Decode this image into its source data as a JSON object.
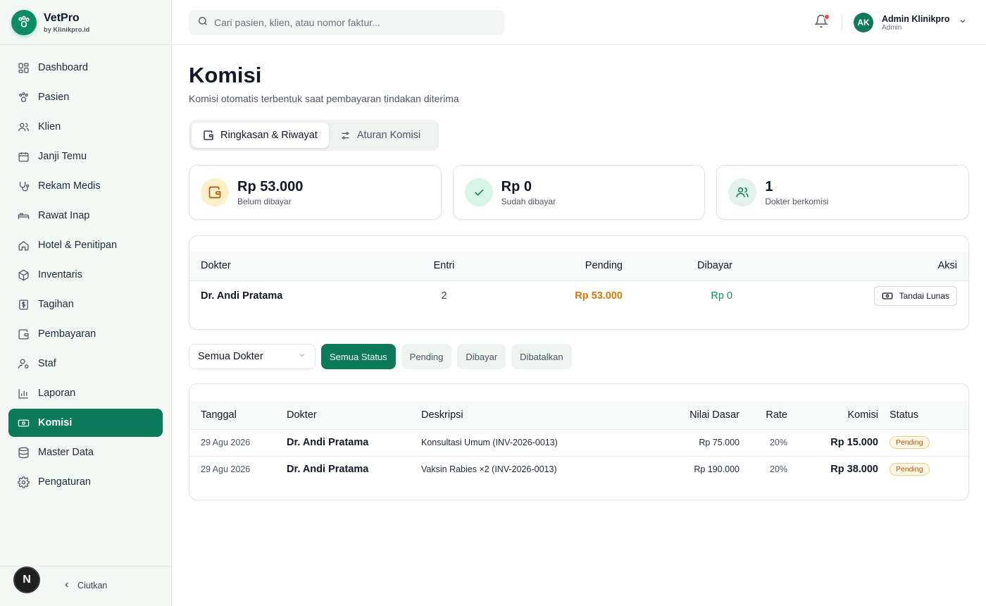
{
  "brand": {
    "name": "VetPro",
    "sub": "by Klinikpro.id"
  },
  "sidebar": {
    "items": [
      {
        "label": "Dashboard",
        "icon": "dashboard-icon"
      },
      {
        "label": "Pasien",
        "icon": "paw-icon"
      },
      {
        "label": "Klien",
        "icon": "users-icon"
      },
      {
        "label": "Janji Temu",
        "icon": "calendar-icon"
      },
      {
        "label": "Rekam Medis",
        "icon": "stethoscope-icon"
      },
      {
        "label": "Rawat Inap",
        "icon": "bed-icon"
      },
      {
        "label": "Hotel & Penitipan",
        "icon": "home-icon"
      },
      {
        "label": "Inventaris",
        "icon": "box-icon"
      },
      {
        "label": "Tagihan",
        "icon": "invoice-icon"
      },
      {
        "label": "Pembayaran",
        "icon": "wallet-icon"
      },
      {
        "label": "Staf",
        "icon": "staff-icon"
      },
      {
        "label": "Laporan",
        "icon": "chart-icon"
      },
      {
        "label": "Komisi",
        "icon": "banknote-icon",
        "active": true
      },
      {
        "label": "Master Data",
        "icon": "database-icon"
      },
      {
        "label": "Pengaturan",
        "icon": "gear-icon"
      }
    ],
    "footer": {
      "badge": "N",
      "collapse_label": "Ciutkan"
    }
  },
  "topbar": {
    "search_placeholder": "Cari pasien, klien, atau nomor faktur...",
    "user": {
      "initials": "AK",
      "name": "Admin Klinikpro",
      "role": "Admin"
    }
  },
  "page": {
    "title": "Komisi",
    "subtitle": "Komisi otomatis terbentuk saat pembayaran tindakan diterima",
    "tabs": [
      {
        "label": "Ringkasan & Riwayat",
        "active": true
      },
      {
        "label": "Aturan Komisi",
        "active": false
      }
    ]
  },
  "stats": [
    {
      "value": "Rp 53.000",
      "label": "Belum dibayar",
      "icon": "wallet-icon",
      "bg": "#fdefc8",
      "fg": "#b45309"
    },
    {
      "value": "Rp 0",
      "label": "Sudah dibayar",
      "icon": "check-icon",
      "bg": "#d7f5e6",
      "fg": "#0d8a66"
    },
    {
      "value": "1",
      "label": "Dokter berkomisi",
      "icon": "users-icon",
      "bg": "#e2f1ea",
      "fg": "#0d7a5c"
    }
  ],
  "summary": {
    "headers": {
      "doctor": "Dokter",
      "entries": "Entri",
      "pending": "Pending",
      "paid": "Dibayar",
      "action": "Aksi"
    },
    "rows": [
      {
        "doctor": "Dr. Andi Pratama",
        "entries": "2",
        "pending": "Rp 53.000",
        "paid": "Rp 0",
        "action": "Tandai Lunas"
      }
    ]
  },
  "filters": {
    "doctor_select": "Semua Dokter",
    "statuses": [
      {
        "label": "Semua Status",
        "active": true
      },
      {
        "label": "Pending",
        "active": false
      },
      {
        "label": "Dibayar",
        "active": false
      },
      {
        "label": "Dibatalkan",
        "active": false
      }
    ]
  },
  "history": {
    "headers": {
      "date": "Tanggal",
      "doctor": "Dokter",
      "desc": "Deskripsi",
      "base": "Nilai Dasar",
      "rate": "Rate",
      "commission": "Komisi",
      "status": "Status"
    },
    "rows": [
      {
        "date": "29 Agu 2026",
        "doctor": "Dr. Andi Pratama",
        "desc": "Konsultasi Umum (INV-2026-0013)",
        "base": "Rp 75.000",
        "rate": "20%",
        "commission": "Rp 15.000",
        "status": "Pending"
      },
      {
        "date": "29 Agu 2026",
        "doctor": "Dr. Andi Pratama",
        "desc": "Vaksin Rabies ×2 (INV-2026-0013)",
        "base": "Rp 190.000",
        "rate": "20%",
        "commission": "Rp 38.000",
        "status": "Pending"
      }
    ]
  },
  "colors": {
    "primary": "#0d7a5c",
    "pending": "#d97706",
    "paid": "#0d8a66"
  }
}
